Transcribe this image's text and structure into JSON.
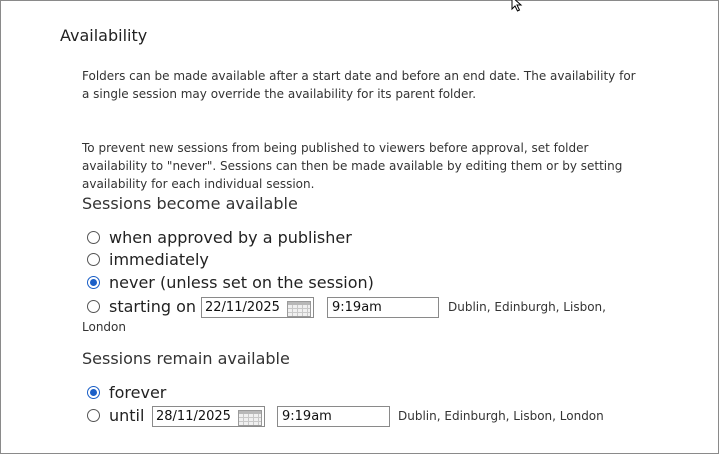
{
  "section": {
    "title": "Availability",
    "description_1": "Folders can be made available after a start date and before an end date. The availability for a single session may override the availability for its parent folder.",
    "description_2": "To prevent new sessions from being published to viewers before approval, set folder availability to \"never\". Sessions can then be made available by editing them or by setting availability for each individual session."
  },
  "become_available": {
    "title": "Sessions become available",
    "options": [
      {
        "label": "when approved by a publisher",
        "checked": false
      },
      {
        "label": "immediately",
        "checked": false
      },
      {
        "label": "never (unless set on the session)",
        "checked": true
      },
      {
        "label": "starting on",
        "checked": false
      }
    ],
    "start_date": "22/11/2025",
    "start_time": "9:19am",
    "timezone_line1": "Dublin, Edinburgh, Lisbon,",
    "timezone_line2": "London"
  },
  "remain_available": {
    "title": "Sessions remain available",
    "options": [
      {
        "label": "forever",
        "checked": true
      },
      {
        "label": "until",
        "checked": false
      }
    ],
    "end_date": "28/11/2025",
    "end_time": "9:19am",
    "timezone": "Dublin, Edinburgh, Lisbon, London"
  },
  "colors": {
    "radio_checked": "#1a5fc7",
    "border": "#8a8a8a"
  },
  "icons": [
    "cursor-icon",
    "calendar-icon"
  ]
}
